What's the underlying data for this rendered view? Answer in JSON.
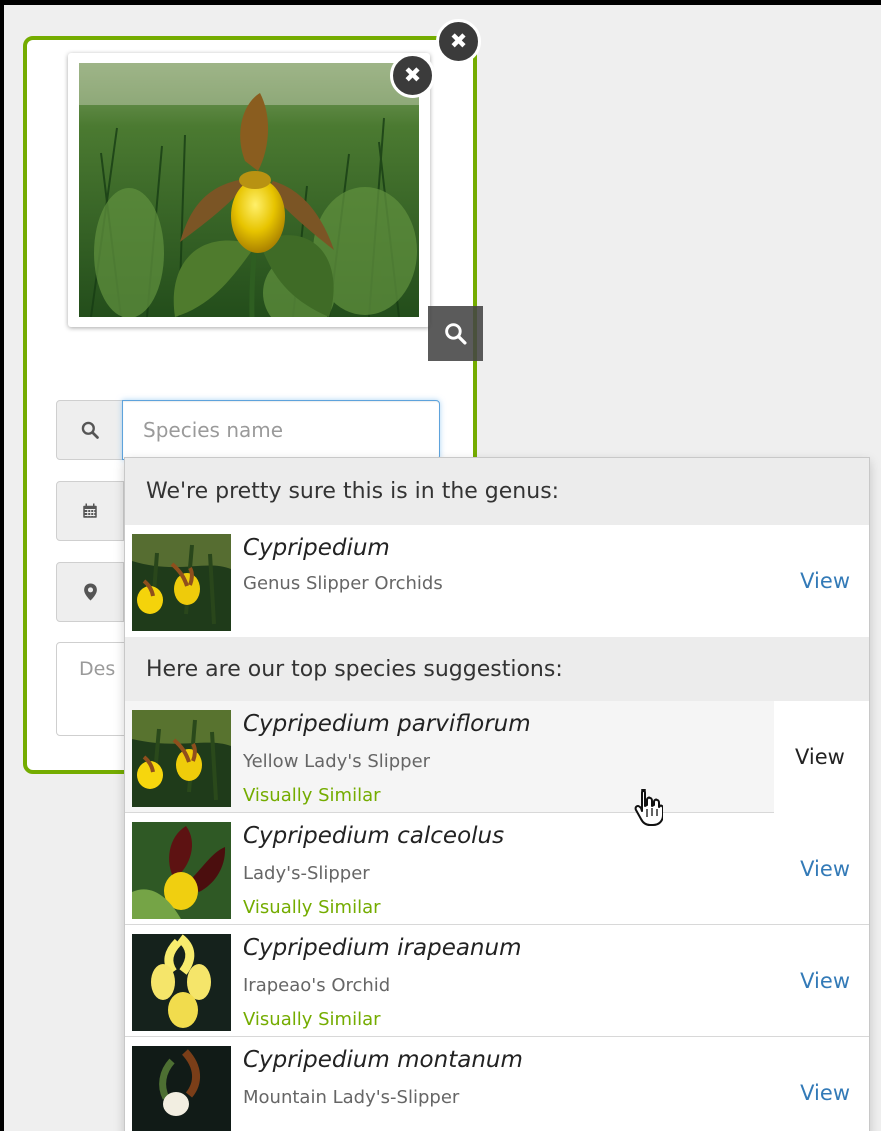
{
  "colors": {
    "accent": "#74ac00",
    "link": "#337ab7",
    "input_focus": "#5ea3dc"
  },
  "card": {
    "close_icon": "close-icon",
    "photo": {
      "close_icon": "close-icon",
      "zoom_icon": "search-icon"
    }
  },
  "species_field": {
    "icon": "search-icon",
    "placeholder": "Species name",
    "value": ""
  },
  "date_field": {
    "icon": "calendar-icon"
  },
  "location_field": {
    "icon": "map-marker-icon"
  },
  "description_field": {
    "visible_text": "Des"
  },
  "dropdown": {
    "genus_header": "We're pretty sure this is in the genus:",
    "genus": {
      "scientific_name": "Cypripedium",
      "common_name": "Genus Slipper Orchids",
      "view_label": "View"
    },
    "species_header": "Here are our top species suggestions:",
    "species": [
      {
        "scientific_name": "Cypripedium parviflorum",
        "common_name": "Yellow Lady's Slipper",
        "tag": "Visually Similar",
        "view_label": "View"
      },
      {
        "scientific_name": "Cypripedium calceolus",
        "common_name": "Lady's-Slipper",
        "tag": "Visually Similar",
        "view_label": "View"
      },
      {
        "scientific_name": "Cypripedium irapeanum",
        "common_name": "Irapeao's Orchid",
        "tag": "Visually Similar",
        "view_label": "View"
      },
      {
        "scientific_name": "Cypripedium montanum",
        "common_name": "Mountain Lady's-Slipper",
        "tag": "",
        "view_label": "View"
      }
    ]
  }
}
